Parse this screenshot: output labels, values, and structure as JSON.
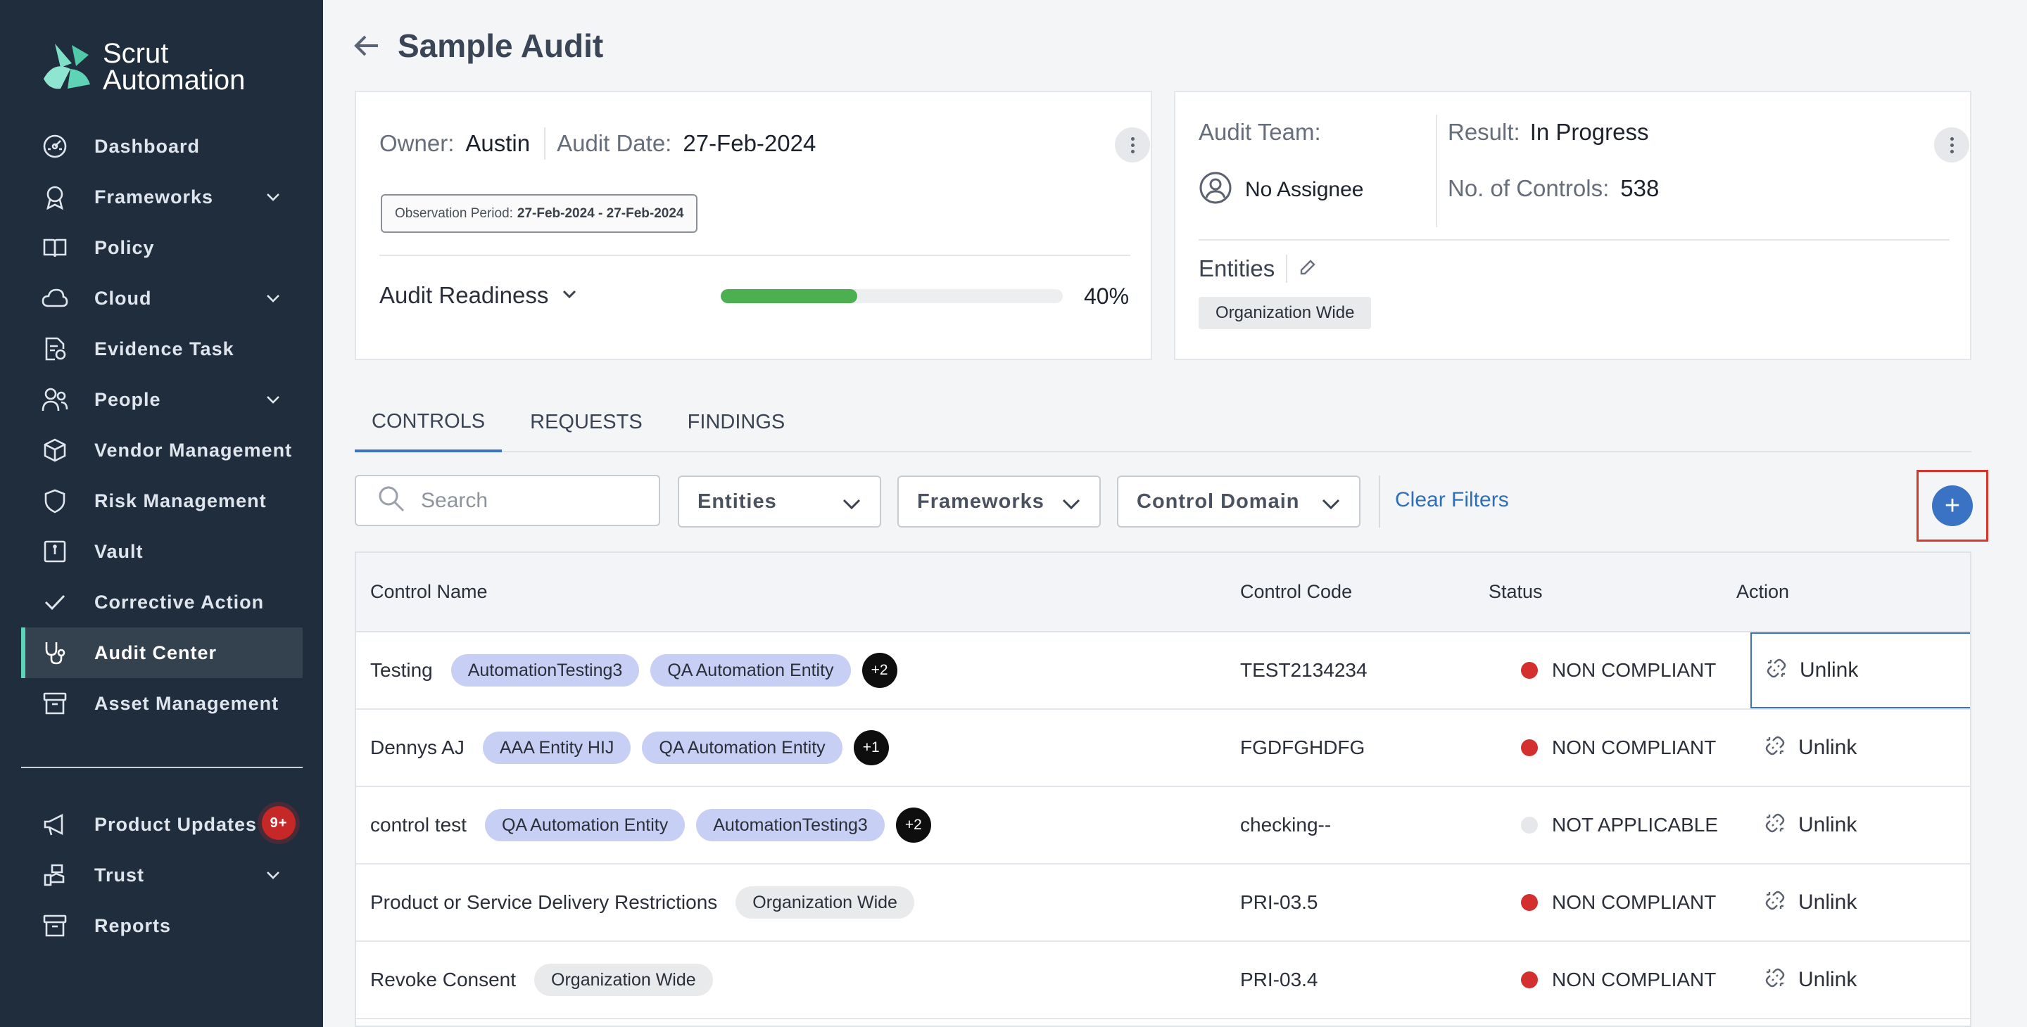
{
  "brand": {
    "line1": "Scrut",
    "line2": "Automation"
  },
  "sidebar": {
    "items": [
      {
        "label": "Dashboard",
        "icon": "dashboard-icon"
      },
      {
        "label": "Frameworks",
        "icon": "award-icon",
        "expandable": true
      },
      {
        "label": "Policy",
        "icon": "book-icon"
      },
      {
        "label": "Cloud",
        "icon": "cloud-icon",
        "expandable": true
      },
      {
        "label": "Evidence Task",
        "icon": "evidence-icon"
      },
      {
        "label": "People",
        "icon": "people-icon",
        "expandable": true
      },
      {
        "label": "Vendor Management",
        "icon": "box-icon"
      },
      {
        "label": "Risk Management",
        "icon": "shield-icon"
      },
      {
        "label": "Vault",
        "icon": "vault-icon"
      },
      {
        "label": "Corrective Action",
        "icon": "check-icon"
      },
      {
        "label": "Audit Center",
        "icon": "stethoscope-icon",
        "active": true
      },
      {
        "label": "Asset Management",
        "icon": "archive-icon"
      }
    ],
    "bottom_items": [
      {
        "label": "Product Updates",
        "icon": "megaphone-icon",
        "badge": "9+"
      },
      {
        "label": "Trust",
        "icon": "trust-icon",
        "expandable": true
      },
      {
        "label": "Reports",
        "icon": "reports-icon"
      }
    ]
  },
  "page": {
    "title": "Sample Audit"
  },
  "audit_card": {
    "owner_label": "Owner:",
    "owner": "Austin",
    "date_label": "Audit Date:",
    "date": "27-Feb-2024",
    "observation_label": "Observation Period:",
    "observation_value": "27-Feb-2024 - 27-Feb-2024",
    "readiness_label": "Audit Readiness",
    "readiness_percent": 40,
    "readiness_text": "40%"
  },
  "team_card": {
    "team_label": "Audit Team:",
    "assignee": "No Assignee",
    "result_label": "Result:",
    "result": "In Progress",
    "controls_label": "No. of Controls:",
    "controls_count": "538",
    "entities_label": "Entities",
    "entity_chip": "Organization Wide"
  },
  "tabs": [
    "CONTROLS",
    "REQUESTS",
    "FINDINGS"
  ],
  "filters": {
    "search_placeholder": "Search",
    "entities": "Entities",
    "frameworks": "Frameworks",
    "control_domain": "Control Domain",
    "clear": "Clear Filters",
    "add_icon": "plus-icon"
  },
  "table": {
    "columns": [
      "Control Name",
      "Control Code",
      "Status",
      "Action"
    ],
    "rows": [
      {
        "name": "Testing",
        "tags": [
          "AutomationTesting3",
          "QA Automation Entity"
        ],
        "more": "+2",
        "code": "TEST2134234",
        "status": "NON COMPLIANT",
        "status_color": "#d32f2f",
        "action": "Unlink"
      },
      {
        "name": "Dennys AJ",
        "tags": [
          "AAA Entity HIJ",
          "QA Automation Entity"
        ],
        "more": "+1",
        "code": "FGDFGHDFG",
        "status": "NON COMPLIANT",
        "status_color": "#d32f2f",
        "action": "Unlink"
      },
      {
        "name": "control test",
        "tags": [
          "QA Automation Entity",
          "AutomationTesting3"
        ],
        "more": "+2",
        "code": "checking--",
        "status": "NOT APPLICABLE",
        "status_color": "#e6e7ea",
        "action": "Unlink"
      },
      {
        "name": "Product or Service Delivery Restrictions",
        "grey_tags": [
          "Organization Wide"
        ],
        "code": "PRI-03.5",
        "status": "NON COMPLIANT",
        "status_color": "#d32f2f",
        "action": "Unlink"
      },
      {
        "name": "Revoke Consent",
        "grey_tags": [
          "Organization Wide"
        ],
        "code": "PRI-03.4",
        "status": "NON COMPLIANT",
        "status_color": "#d32f2f",
        "action": "Unlink"
      }
    ]
  },
  "colors": {
    "sidebar_bg": "#1f2d3d",
    "accent": "#3b73c4",
    "brand_teal": "#5ed3b6",
    "progress": "#4caf50"
  }
}
